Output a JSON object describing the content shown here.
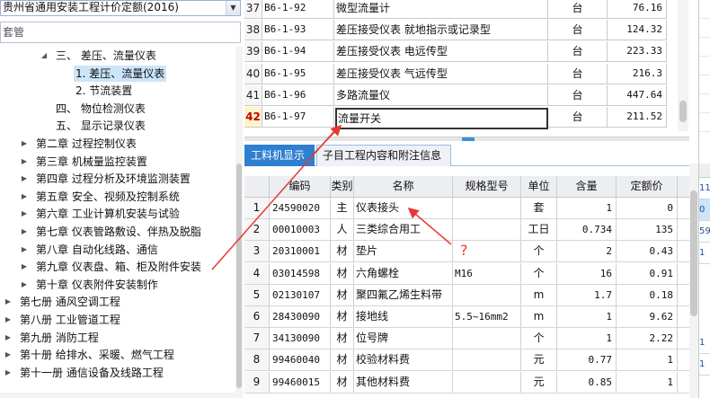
{
  "library": {
    "selected": "贵州省通用安装工程计价定额(2016)"
  },
  "search": {
    "text": "套管"
  },
  "tree": {
    "nodes": [
      {
        "label": "三、 差压、流量仪表",
        "level": 2,
        "arrow": "expanded"
      },
      {
        "label": "1. 差压、流量仪表",
        "level": 3,
        "arrow": "none",
        "selected": true
      },
      {
        "label": "2. 节流装置",
        "level": 3,
        "arrow": "none"
      },
      {
        "label": "四、 物位检测仪表",
        "level": 2,
        "arrow": "none"
      },
      {
        "label": "五、 显示记录仪表",
        "level": 2,
        "arrow": "none"
      },
      {
        "label": "第二章 过程控制仪表",
        "level": 1,
        "arrow": "collapsed"
      },
      {
        "label": "第三章 机械量监控装置",
        "level": 1,
        "arrow": "collapsed"
      },
      {
        "label": "第四章 过程分析及环境监测装置",
        "level": 1,
        "arrow": "collapsed"
      },
      {
        "label": "第五章 安全、视频及控制系统",
        "level": 1,
        "arrow": "collapsed"
      },
      {
        "label": "第六章 工业计算机安装与试验",
        "level": 1,
        "arrow": "collapsed"
      },
      {
        "label": "第七章 仪表管路敷设、伴热及脱脂",
        "level": 1,
        "arrow": "collapsed"
      },
      {
        "label": "第八章 自动化线路、通信",
        "level": 1,
        "arrow": "collapsed"
      },
      {
        "label": "第九章 仪表盘、箱、柜及附件安装",
        "level": 1,
        "arrow": "collapsed"
      },
      {
        "label": "第十章 仪表附件安装制作",
        "level": 1,
        "arrow": "collapsed"
      },
      {
        "label": "第七册 通风空调工程",
        "level": 0,
        "arrow": "collapsed"
      },
      {
        "label": "第八册 工业管道工程",
        "level": 0,
        "arrow": "collapsed"
      },
      {
        "label": "第九册 消防工程",
        "level": 0,
        "arrow": "collapsed"
      },
      {
        "label": "第十册 给排水、采暖、燃气工程",
        "level": 0,
        "arrow": "collapsed"
      },
      {
        "label": "第十一册 通信设备及线路工程",
        "level": 0,
        "arrow": "collapsed"
      }
    ]
  },
  "quota_rows": [
    {
      "num": "37",
      "code": "B6-1-92",
      "name": "微型流量计",
      "unit": "台",
      "price": "76.16"
    },
    {
      "num": "38",
      "code": "B6-1-93",
      "name": "差压接受仪表 就地指示或记录型",
      "unit": "台",
      "price": "124.32"
    },
    {
      "num": "39",
      "code": "B6-1-94",
      "name": "差压接受仪表 电远传型",
      "unit": "台",
      "price": "223.33"
    },
    {
      "num": "40",
      "code": "B6-1-95",
      "name": "差压接受仪表 气远传型",
      "unit": "台",
      "price": "216.3"
    },
    {
      "num": "41",
      "code": "B6-1-96",
      "name": "多路流量仪",
      "unit": "台",
      "price": "447.64"
    },
    {
      "num": "42",
      "code": "B6-1-97",
      "name": "流量开关",
      "unit": "台",
      "price": "211.52",
      "current": true
    }
  ],
  "tabs": [
    {
      "label": "工料机显示",
      "active": true
    },
    {
      "label": "子目工程内容和附注信息",
      "active": false
    }
  ],
  "resource_headers": [
    "编码",
    "类别",
    "名称",
    "规格型号",
    "单位",
    "含量",
    "定额价"
  ],
  "resource_rows": [
    {
      "idx": "1",
      "code": "24590020",
      "type": "主",
      "name": "仪表接头",
      "spec": "",
      "unit": "套",
      "qty": "1",
      "price": "0"
    },
    {
      "idx": "2",
      "code": "00010003",
      "type": "人",
      "name": "三类综合用工",
      "spec": "",
      "unit": "工日",
      "qty": "0.734",
      "price": "135"
    },
    {
      "idx": "3",
      "code": "20310001",
      "type": "材",
      "name": "垫片",
      "spec": "",
      "unit": "个",
      "qty": "2",
      "price": "0.43"
    },
    {
      "idx": "4",
      "code": "03014598",
      "type": "材",
      "name": "六角螺栓",
      "spec": "M16",
      "unit": "个",
      "qty": "16",
      "price": "0.91"
    },
    {
      "idx": "5",
      "code": "02130107",
      "type": "材",
      "name": "聚四氟乙烯生料带",
      "spec": "",
      "unit": "m",
      "qty": "1.7",
      "price": "0.18"
    },
    {
      "idx": "6",
      "code": "28430090",
      "type": "材",
      "name": "接地线",
      "spec": "5.5~16mm2",
      "unit": "m",
      "qty": "1",
      "price": "9.62"
    },
    {
      "idx": "7",
      "code": "34130090",
      "type": "材",
      "name": "位号牌",
      "spec": "",
      "unit": "个",
      "qty": "1",
      "price": "2.22"
    },
    {
      "idx": "8",
      "code": "99460040",
      "type": "材",
      "name": "校验材料费",
      "spec": "",
      "unit": "元",
      "qty": "0.77",
      "price": "1"
    },
    {
      "idx": "9",
      "code": "99460015",
      "type": "材",
      "name": "其他材料费",
      "spec": "",
      "unit": "元",
      "qty": "0.85",
      "price": "1"
    }
  ],
  "right_strip": [
    "11",
    "0",
    "59",
    "1",
    "1",
    "1"
  ],
  "annotation": {
    "text": "?"
  },
  "colors": {
    "arrow": "#e53935",
    "tab_active": "#2f7fd0",
    "selection": "#cbe5fb",
    "current_row_number": "#c00000"
  },
  "icons": {
    "tree_expanded": "triangle-down-icon",
    "tree_collapsed": "triangle-right-icon",
    "dropdown": "chevron-down-icon"
  }
}
